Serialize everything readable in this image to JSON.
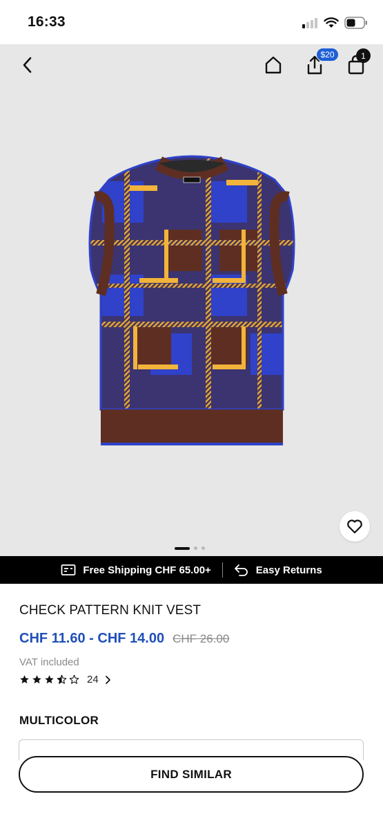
{
  "status_bar": {
    "time": "16:33"
  },
  "header": {
    "share_badge": "$20",
    "cart_count": "1"
  },
  "gallery": {
    "image_count": 3,
    "active_index": 0
  },
  "promo": {
    "shipping_text": "Free Shipping CHF 65.00+",
    "returns_text": "Easy Returns"
  },
  "product": {
    "title": "CHECK PATTERN KNIT VEST",
    "price_range": "CHF 11.60 - CHF 14.00",
    "original_price": "CHF 26.00",
    "vat_note": "VAT included",
    "rating_value": 3.5,
    "review_count": "24",
    "color_label": "MULTICOLOR"
  },
  "actions": {
    "find_similar": "FIND SIMILAR"
  },
  "colors": {
    "price_blue": "#1f4fb8",
    "badge_blue": "#1e5fd6",
    "vest_brown": "#5e2e22",
    "vest_blue": "#2f42c9",
    "vest_yellow": "#f2b43a"
  }
}
